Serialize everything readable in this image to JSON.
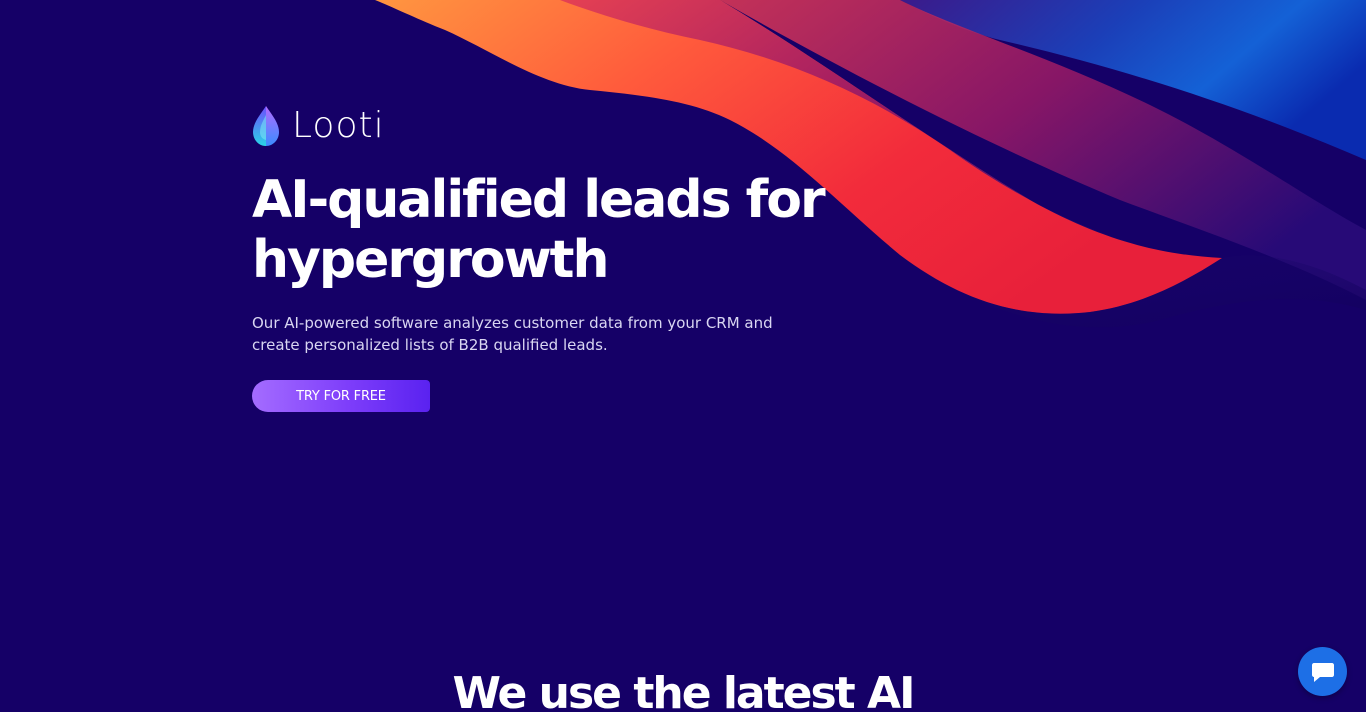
{
  "brand": {
    "name": "Looti",
    "logo_icon": "looti-drop-icon"
  },
  "hero": {
    "headline": "AI-qualified leads for hypergrowth",
    "subtitle": "Our AI-powered software analyzes customer data from your CRM  and create personalized lists of B2B qualified leads.",
    "cta_label": "TRY FOR FREE"
  },
  "section": {
    "title": "We use the latest AI"
  },
  "chat_widget": {
    "icon": "chat-bubble-icon"
  },
  "colors": {
    "background": "#150067",
    "accent_purple": "#7d3dfa",
    "wave_orange": "#ff6a3d",
    "wave_red": "#f0283a",
    "wave_blue": "#1a4fd8",
    "chat_blue": "#1d6fe6"
  }
}
